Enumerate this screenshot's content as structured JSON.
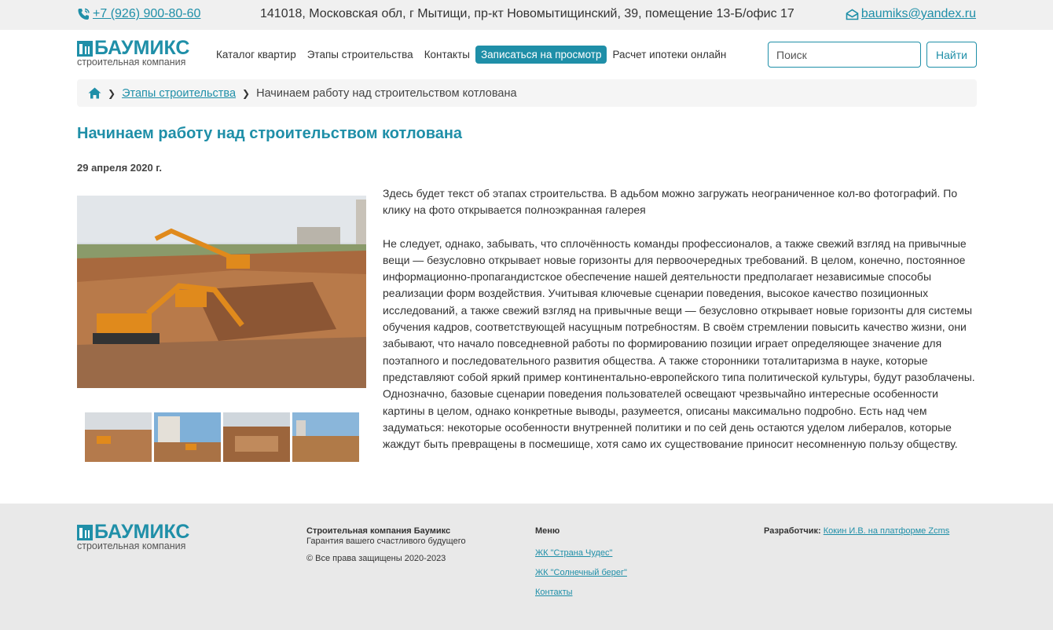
{
  "topbar": {
    "phone": "+7 (926) 900-80-60",
    "address": "141018, Московская обл, г Мытищи, пр-кт Новомытищинский, 39, помещение 13-Б/офис 17",
    "email": "baumiks@yandex.ru"
  },
  "logo": {
    "name": "БАУМИКС",
    "subtitle": "строительная компания"
  },
  "nav": {
    "items": [
      {
        "label": "Каталог квартир"
      },
      {
        "label": "Этапы строительства"
      },
      {
        "label": "Контакты"
      },
      {
        "label": "Записаться на просмотр"
      },
      {
        "label": "Расчет ипотеки онлайн"
      }
    ]
  },
  "search": {
    "placeholder": "Поиск",
    "button": "Найти"
  },
  "breadcrumb": {
    "link": "Этапы строительства",
    "current": "Начинаем работу над строительством котлована"
  },
  "article": {
    "title": "Начинаем работу над строительством котлована",
    "date": "29 апреля 2020 г.",
    "intro": "Здесь будет текст об этапах строительства. В адьбом можно загружать неограниченное кол-во фотографий. По клику на фото открывается полноэкранная галерея",
    "body": "Не следует, однако, забывать, что сплочённость команды профессионалов, а также свежий взгляд на привычные вещи — безусловно открывает новые горизонты для первоочередных требований. В целом, конечно, постоянное информационно-пропагандистское обеспечение нашей деятельности предполагает независимые способы реализации форм воздействия. Учитывая ключевые сценарии поведения, высокое качество позиционных исследований, а также свежий взгляд на привычные вещи — безусловно открывает новые горизонты для системы обучения кадров, соответствующей насущным потребностям. В своём стремлении повысить качество жизни, они забывают, что начало повседневной работы по формированию позиции играет определяющее значение для поэтапного и последовательного развития общества. А также сторонники тоталитаризма в науке, которые представляют собой яркий пример континентально-европейского типа политической культуры, будут разоблачены. Однозначно, базовые сценарии поведения пользователей освещают чрезвычайно интересные особенности картины в целом, однако конкретные выводы, разумеется, описаны максимально подробно. Есть над чем задуматься: некоторые особенности внутренней политики и по сей день остаются уделом либералов, которые жаждут быть превращены в посмешище, хотя само их существование приносит несомненную пользу обществу."
  },
  "footer": {
    "company_title": "Строительная компания Баумикс",
    "company_tagline": "Гарантия вашего счастливого будущего",
    "copyright": "© Все права защищены 2020-2023",
    "menu_title": "Меню",
    "menu": [
      {
        "label": "ЖК \"Страна Чудес\""
      },
      {
        "label": "ЖК \"Солнечный берег\""
      },
      {
        "label": "Контакты"
      }
    ],
    "dev_label": "Разработчик:",
    "dev_link": "Кокин И.В. на платформе Zcms"
  },
  "colors": {
    "accent": "#1f8fa8",
    "topbar_bg": "#f0f0f0",
    "footer_bg": "#e9e9e9"
  }
}
